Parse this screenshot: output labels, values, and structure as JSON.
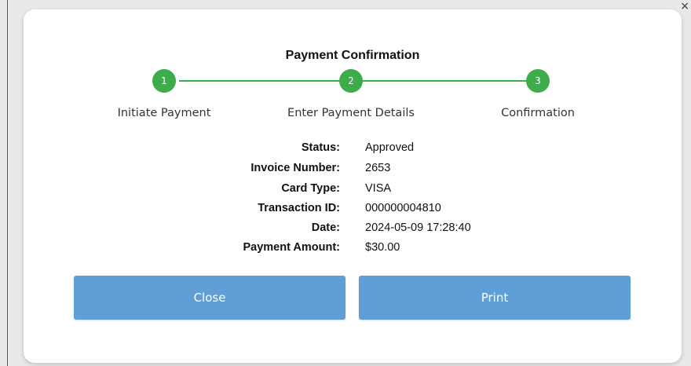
{
  "window": {
    "dismiss_glyph": "×"
  },
  "modal": {
    "title": "Payment Confirmation",
    "steps": [
      {
        "number": "1",
        "label": "Initiate Payment"
      },
      {
        "number": "2",
        "label": "Enter Payment Details"
      },
      {
        "number": "3",
        "label": "Confirmation"
      }
    ],
    "step_color": "#3cad4a",
    "details": [
      {
        "label": "Status:",
        "value": "Approved"
      },
      {
        "label": "Invoice Number:",
        "value": "2653"
      },
      {
        "label": "Card Type:",
        "value": "VISA"
      },
      {
        "label": "Transaction ID:",
        "value": "000000004810"
      },
      {
        "label": "Date:",
        "value": "2024-05-09 17:28:40"
      },
      {
        "label": "Payment Amount:",
        "value": "$30.00"
      }
    ],
    "buttons": {
      "close_label": "Close",
      "print_label": "Print"
    },
    "button_color": "#5f9ed6"
  }
}
